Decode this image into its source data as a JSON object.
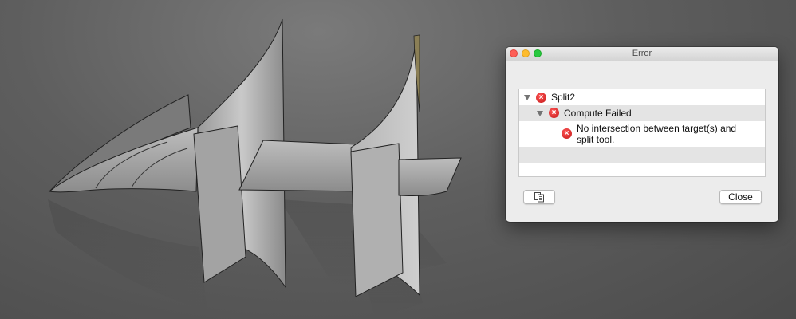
{
  "dialog": {
    "title": "Error",
    "tree": {
      "root": {
        "label": "Split2"
      },
      "child": {
        "label": "Compute Failed"
      },
      "message": {
        "line1": "No intersection between target(s) and",
        "line2": "split tool."
      }
    },
    "buttons": {
      "copy_icon": "copy-clipboard-icon",
      "close_label": "Close"
    }
  },
  "icons": {
    "error": "error-x-icon",
    "disclosure": "disclosure-triangle-icon"
  },
  "colors": {
    "error_red": "#d42a2a",
    "close_light": "#fe5f57",
    "minimize_light": "#febc2e",
    "zoom_light": "#28c840"
  }
}
